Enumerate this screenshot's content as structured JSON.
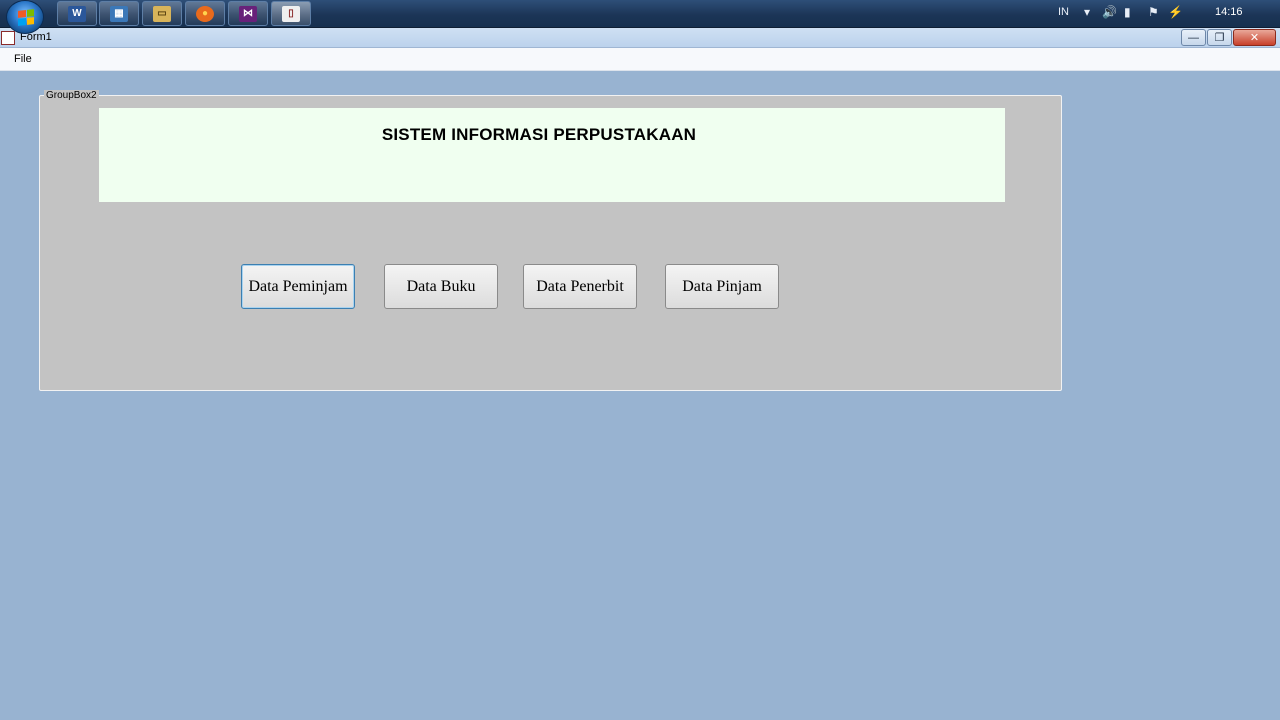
{
  "taskbar": {
    "apps": [
      {
        "name": "word",
        "glyph": "W",
        "color": "#2b579a"
      },
      {
        "name": "calculator",
        "glyph": "▦",
        "color": "#3b78b8"
      },
      {
        "name": "explorer",
        "glyph": "▭",
        "color": "#d8b45a"
      },
      {
        "name": "firefox",
        "glyph": "●",
        "color": "#e86a1c"
      },
      {
        "name": "visual-studio",
        "glyph": "⋈",
        "color": "#68217a"
      },
      {
        "name": "book-app",
        "glyph": "▯",
        "color": "#efefef"
      }
    ],
    "tray": {
      "language": "IN",
      "clock": "14:16"
    }
  },
  "window": {
    "title": "Form1",
    "minimize_glyph": "—",
    "restore_glyph": "❐",
    "close_glyph": "✕"
  },
  "menu": {
    "file": "File"
  },
  "groupbox": {
    "legend": "GroupBox2",
    "banner_title": "SISTEM INFORMASI PERPUSTAKAAN",
    "buttons": [
      {
        "label": "Data Peminjam"
      },
      {
        "label": "Data Buku"
      },
      {
        "label": "Data Penerbit"
      },
      {
        "label": "Data Pinjam"
      }
    ]
  },
  "colors": {
    "desktop": "#98b3d1",
    "groupbox": "#c3c3c3",
    "banner": "#f0fff0",
    "focus_border": "#3c7fb1"
  }
}
